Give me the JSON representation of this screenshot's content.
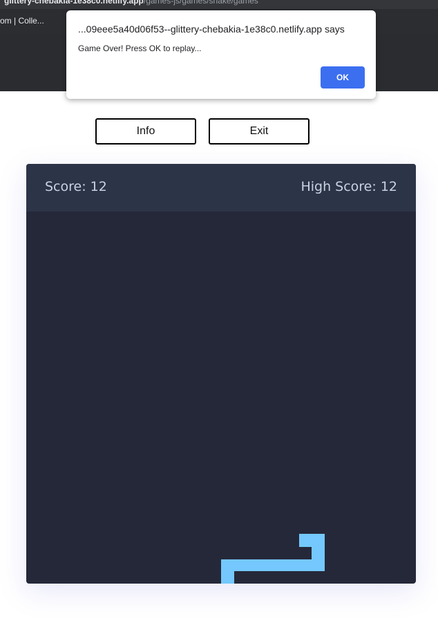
{
  "browser": {
    "url_host": "glittery-chebakia-1e38c0.netlify.app",
    "url_path": "/games-js/games/snake/games",
    "bookmark_item": "om | Colle..."
  },
  "alert": {
    "title": "...09eee5a40d06f53--glittery-chebakia-1e38c0.netlify.app says",
    "message": "Game Over! Press OK to replay...",
    "ok_label": "OK"
  },
  "controls": {
    "info_label": "Info",
    "exit_label": "Exit"
  },
  "game": {
    "score_text": "Score: 12",
    "high_score_text": "High Score: 12",
    "snake_color": "#74c8fd",
    "board_color": "#252839",
    "header_color": "#2c3447"
  },
  "colors": {
    "alert_button": "#3c6ff0"
  }
}
